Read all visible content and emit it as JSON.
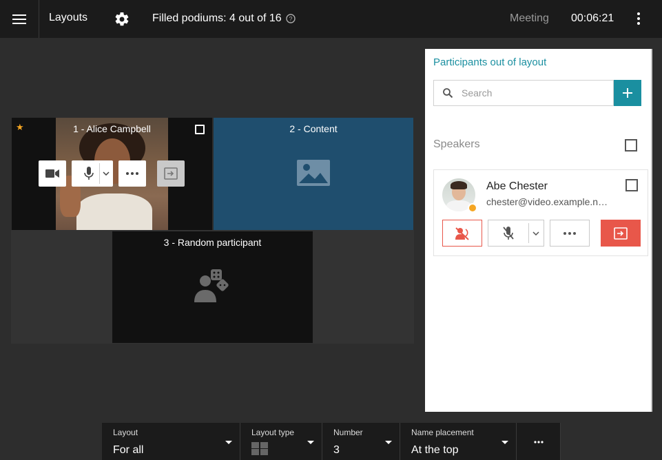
{
  "topbar": {
    "title": "Layouts",
    "podiums": "Filled podiums: 4 out of 16",
    "meeting": "Meeting",
    "timer": "00:06:21"
  },
  "tiles": {
    "t1": "1 - Alice Campbell",
    "t2": "2 - Content",
    "t3": "3 - Random participant"
  },
  "panel": {
    "title": "Participants out of layout",
    "search_placeholder": "Search",
    "speakers": "Speakers",
    "participant": {
      "name": "Abe Chester",
      "email": "chester@video.example.n…"
    }
  },
  "bottom": {
    "layout": {
      "label": "Layout",
      "value": "For all"
    },
    "layout_type": {
      "label": "Layout type"
    },
    "number": {
      "label": "Number",
      "value": "3"
    },
    "name_placement": {
      "label": "Name placement",
      "value": "At the top"
    }
  },
  "colors": {
    "accent": "#1a8fa0",
    "danger": "#e8574a",
    "content_tile": "#1f4e6e",
    "status": "#f5a623"
  }
}
